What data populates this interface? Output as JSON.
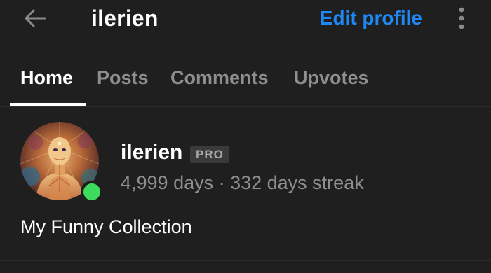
{
  "app_bar": {
    "title": "ilerien",
    "edit_profile_label": "Edit profile",
    "back_icon": "arrow-left-icon",
    "more_icon": "more-vertical-icon"
  },
  "tabs": [
    {
      "label": "Home",
      "active": true
    },
    {
      "label": "Posts",
      "active": false
    },
    {
      "label": "Comments",
      "active": false
    },
    {
      "label": "Upvotes",
      "active": false
    }
  ],
  "profile": {
    "username": "ilerien",
    "badge": "PRO",
    "stats": "4,999 days · 332 days streak",
    "online": true,
    "bio": "My Funny Collection"
  },
  "colors": {
    "background": "#1f1f1f",
    "accent": "#1e88f5",
    "muted_text": "#8e8e8e",
    "online": "#3ddc5c"
  }
}
